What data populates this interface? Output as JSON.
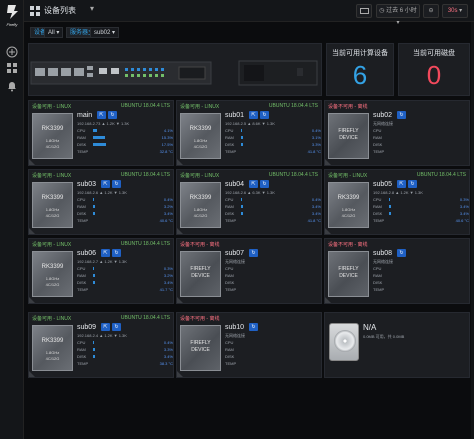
{
  "app": {
    "logo_text": "Firefly",
    "title": "设备列表",
    "time_range": "过去 6 小时",
    "refresh": "30s"
  },
  "variables": {
    "label1": "设备",
    "value1": "All",
    "label2": "服务器主机",
    "value2": "sub02"
  },
  "stats": [
    {
      "title": "当前可用计算设备",
      "value": "6",
      "color": "#33a2e5"
    },
    {
      "title": "当前可用磁盘",
      "value": "0",
      "color": "#f2495c"
    }
  ],
  "cards": [
    {
      "id": "main",
      "online": true,
      "status": "设备可用 - LINUX",
      "os": "UBUNTU 18.04.4 LTS",
      "chip": "RK3399",
      "freq": "1.8GHz",
      "cores": "4C/12G",
      "ip": "192.168.2.73  ▲ 1.2K  ▼ 1.3K",
      "cpu": "4.1%",
      "cpu_p": 6,
      "ram": "15.3%",
      "ram_p": 20,
      "disk": "17.5%",
      "disk_p": 22,
      "temp": "32.8 °C"
    },
    {
      "id": "sub01",
      "online": true,
      "status": "设备可用 - LINUX",
      "os": "UBUNTU 18.04.4 LTS",
      "chip": "RK3399",
      "freq": "1.8GHz",
      "cores": "4C/12G",
      "ip": "192.168.2.5  ▲ 8.6K  ▼ 1.3K",
      "cpu": "0.4%",
      "cpu_p": 1,
      "ram": "3.1%",
      "ram_p": 4,
      "disk": "3.3%",
      "disk_p": 4,
      "temp": "41.8 °C"
    },
    {
      "id": "sub02",
      "online": false,
      "status": "设备不可用 - 离线",
      "os": "",
      "chip": "FIREFLY DEVICE",
      "offline": "无网络连接",
      "labels": [
        "CPU",
        "RAM",
        "DISK",
        "TEMP"
      ]
    },
    {
      "id": "sub03",
      "online": true,
      "status": "设备可用 - LINUX",
      "os": "UBUNTU 18.04.4 LTS",
      "chip": "RK3399",
      "freq": "1.8GHz",
      "cores": "4C/12G",
      "ip": "192.168.2.6  ▲ 1.2K  ▼ 1.3K",
      "cpu": "0.4%",
      "cpu_p": 1,
      "ram": "3.2%",
      "ram_p": 4,
      "disk": "3.4%",
      "disk_p": 4,
      "temp": "40.6 °C"
    },
    {
      "id": "sub04",
      "online": true,
      "status": "设备可用 - LINUX",
      "os": "UBUNTU 18.04.4 LTS",
      "chip": "RK3399",
      "freq": "1.8GHz",
      "cores": "4C/12G",
      "ip": "192.168.2.6  ▲ 6.3K  ▼ 1.3K",
      "cpu": "0.4%",
      "cpu_p": 1,
      "ram": "3.4%",
      "ram_p": 4,
      "disk": "3.4%",
      "disk_p": 4,
      "temp": "41.8 °C"
    },
    {
      "id": "sub05",
      "online": true,
      "status": "设备可用 - LINUX",
      "os": "UBUNTU 18.04.4 LTS",
      "chip": "RK3399",
      "freq": "1.8GHz",
      "cores": "4C/12G",
      "ip": "192.168.2.8  ▲ 1.2K  ▼ 1.3K",
      "cpu": "0.3%",
      "cpu_p": 1,
      "ram": "3.4%",
      "ram_p": 4,
      "disk": "3.4%",
      "disk_p": 4,
      "temp": "40.6 °C"
    },
    {
      "id": "sub06",
      "online": true,
      "status": "设备可用 - LINUX",
      "os": "UBUNTU 18.04.4 LTS",
      "chip": "RK3399",
      "freq": "1.8GHz",
      "cores": "4C/12G",
      "ip": "192.168.2.7  ▲ 1.2K  ▼ 1.3K",
      "cpu": "0.3%",
      "cpu_p": 1,
      "ram": "3.2%",
      "ram_p": 4,
      "disk": "3.4%",
      "disk_p": 4,
      "temp": "41.7 °C"
    },
    {
      "id": "sub07",
      "online": false,
      "status": "设备不可用 - 离线",
      "os": "",
      "chip": "FIREFLY DEVICE",
      "offline": "无网络连接",
      "labels": [
        "CPU",
        "RAM",
        "DISK",
        "TEMP"
      ]
    },
    {
      "id": "sub08",
      "online": false,
      "status": "设备不可用 - 离线",
      "os": "",
      "chip": "FIREFLY DEVICE",
      "offline": "无网络连接",
      "labels": [
        "CPU",
        "RAM",
        "DISK",
        "TEMP"
      ]
    },
    {
      "id": "sub09",
      "online": true,
      "status": "设备可用 - LINUX",
      "os": "UBUNTU 18.04.4 LTS",
      "chip": "RK3399",
      "freq": "1.8GHz",
      "cores": "4C/12G",
      "ip": "192.168.2.4  ▲ 1.2K  ▼ 1.3K",
      "cpu": "0.4%",
      "cpu_p": 1,
      "ram": "3.3%",
      "ram_p": 4,
      "disk": "3.4%",
      "disk_p": 4,
      "temp": "38.3 °C"
    },
    {
      "id": "sub10",
      "online": false,
      "status": "设备不可用 - 离线",
      "os": "",
      "chip": "FIREFLY DEVICE",
      "offline": "无网络连接",
      "labels": [
        "CPU",
        "RAM",
        "DISK",
        "TEMP"
      ]
    }
  ],
  "na_card": {
    "title": "N/A",
    "sub": "0.0MB 可用，共 0.0MB"
  },
  "colors": {
    "accent": "#33a2e5",
    "ok": "#73bf69",
    "bad": "#f2495c"
  }
}
